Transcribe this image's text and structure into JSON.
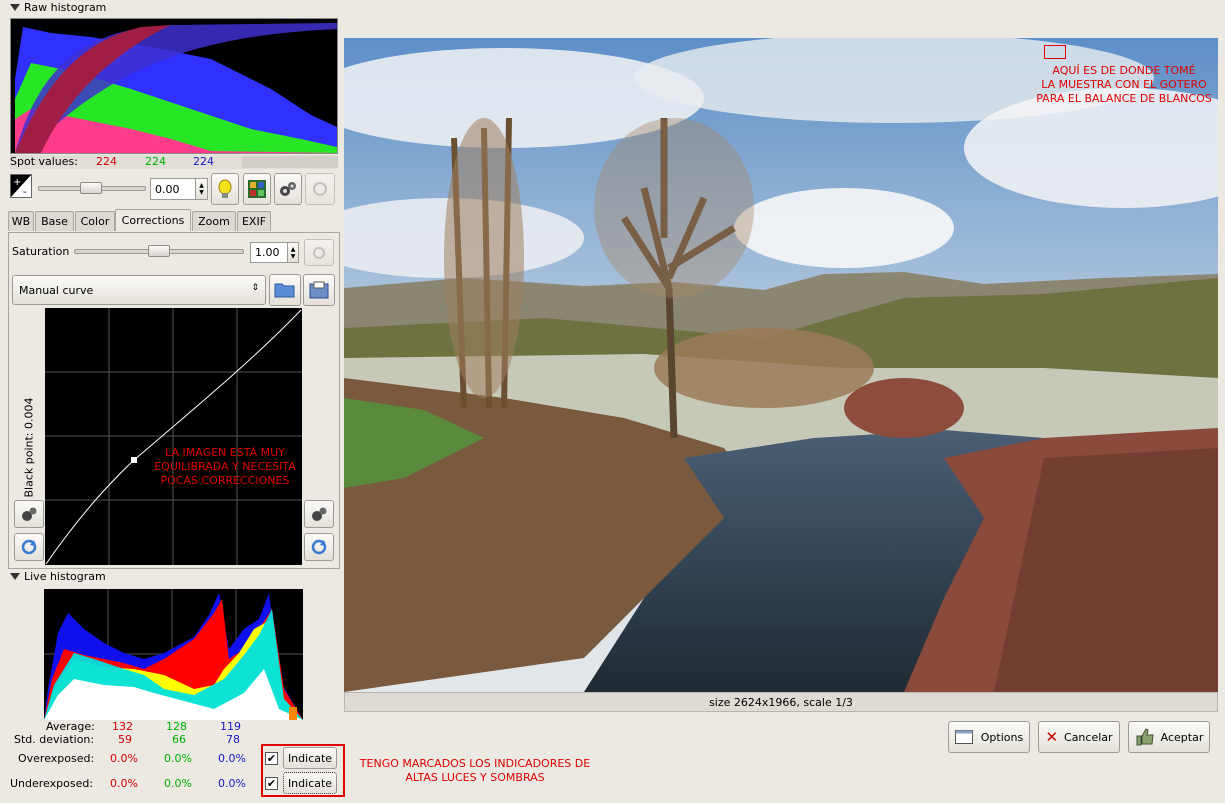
{
  "raw_histogram": {
    "label": "Raw histogram"
  },
  "spot": {
    "label": "Spot values:",
    "r": "224",
    "g": "224",
    "b": "224"
  },
  "exposure": {
    "value": "0.00"
  },
  "tabs": [
    "WB",
    "Base",
    "Color",
    "Corrections",
    "Zoom",
    "EXIF"
  ],
  "active_tab": "Corrections",
  "saturation": {
    "label": "Saturation",
    "value": "1.00",
    "level": 0.5
  },
  "curve": {
    "selected": "Manual curve",
    "black_point": "Black point: 0.004",
    "annotation": [
      "LA IMAGEN ESTÁ MUY",
      "EQUILIBRADA Y NECESITA",
      "POCAS CORRECCIONES"
    ]
  },
  "live_histogram": {
    "label": "Live histogram"
  },
  "stats": {
    "average": {
      "label": "Average:",
      "r": "132",
      "g": "128",
      "b": "119"
    },
    "std": {
      "label": "Std. deviation:",
      "r": "59",
      "g": "66",
      "b": "78"
    },
    "over": {
      "label": "Overexposed:",
      "r": "0.0%",
      "g": "0.0%",
      "b": "0.0%",
      "button": "Indicate"
    },
    "under": {
      "label": "Underexposed:",
      "r": "0.0%",
      "g": "0.0%",
      "b": "0.0%",
      "button": "Indicate"
    }
  },
  "indicators_note": [
    "TENGO MARCADOS LOS INDICADORES DE",
    "ALTAS LUCES Y SOMBRAS"
  ],
  "image": {
    "status": "size 2624x1966, scale 1/3",
    "annotation": [
      "AQUÍ ES DE DONDE TOMÉ",
      "LA MUESTRA CON EL GOTERO",
      "PARA EL BALANCE DE BLANCOS"
    ]
  },
  "buttons": {
    "options": "Options",
    "cancel": "Cancelar",
    "accept": "Aceptar"
  },
  "colors": {
    "annotation_red": "#e00000",
    "highlight_border": "#e00000"
  }
}
